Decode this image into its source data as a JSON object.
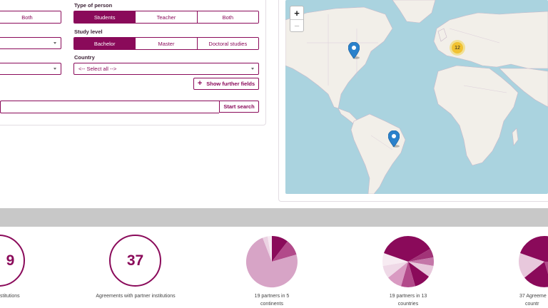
{
  "search": {
    "left_toggle": {
      "visible_option": "Both"
    },
    "type_of_person": {
      "label": "Type of person",
      "options": [
        "Students",
        "Teacher",
        "Both"
      ],
      "selected": "Students"
    },
    "study_level": {
      "label": "Study level",
      "options": [
        "Bachelor",
        "Master",
        "Doctoral studies"
      ],
      "selected": "Bachelor"
    },
    "country": {
      "label": "Country",
      "value": "<-- Select all -->"
    },
    "show_further_fields": "Show further fields",
    "start_search": "Start search"
  },
  "map": {
    "zoom_in": "+",
    "zoom_out": "−",
    "cluster_count": "12",
    "pin_color": "#2a81cb"
  },
  "stats": {
    "item1": {
      "value": "9",
      "label": "stitutions"
    },
    "item2": {
      "value": "37",
      "label": "Agreements with partner institutions"
    },
    "item3": {
      "label_line1": "19 partners in 5",
      "label_line2": "continents"
    },
    "item4": {
      "label_line1": "19 partners in 13",
      "label_line2": "countries"
    },
    "item5": {
      "label_line1": "37 Agreeme",
      "label_line2": "countr"
    }
  },
  "colors": {
    "accent": "#8a0a5a",
    "band": "#c8c8c8",
    "water": "#aad3df",
    "land": "#f2efe9"
  }
}
